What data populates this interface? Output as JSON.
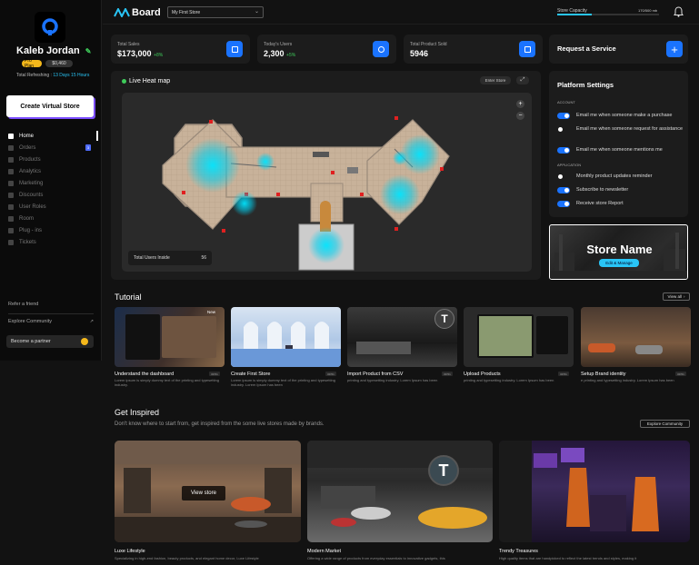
{
  "sidebar": {
    "user": {
      "name": "Kaleb Jordan",
      "plan_badge": "Pro Plan",
      "balance_badge": "$0,460",
      "refresh_label": "Total Refreshing :",
      "refresh_value": "13 Days 15 Hours"
    },
    "create_button": "Create Virtual Store",
    "nav": [
      {
        "label": "Home",
        "icon": "home-icon",
        "active": true
      },
      {
        "label": "Orders",
        "icon": "orders-icon",
        "badge": "3"
      },
      {
        "label": "Products",
        "icon": "products-icon"
      },
      {
        "label": "Analytics",
        "icon": "analytics-icon"
      },
      {
        "label": "Marketing",
        "icon": "marketing-icon"
      },
      {
        "label": "Discounts",
        "icon": "discounts-icon"
      },
      {
        "label": "User Roles",
        "icon": "user-roles-icon"
      },
      {
        "label": "Room",
        "icon": "room-icon"
      },
      {
        "label": "Plug - ins",
        "icon": "plugins-icon"
      },
      {
        "label": "Tickets",
        "icon": "tickets-icon"
      }
    ],
    "refer": "Refer a friend",
    "explore_community": "Explore Community",
    "partner": "Become a partner"
  },
  "topbar": {
    "title": "Board",
    "store_select": "My First Store",
    "capacity_label": "Store Capacity",
    "capacity_value": "170/500 mb",
    "capacity_fraction": 0.34
  },
  "stats": [
    {
      "label": "Total Sales",
      "value": "$173,000",
      "delta": "+8%",
      "icon": "cart-icon"
    },
    {
      "label": "Today's Users",
      "value": "2,300",
      "delta": "+5%",
      "icon": "globe-icon"
    },
    {
      "label": "Total Product Sold",
      "value": "5946",
      "delta": "",
      "icon": "document-icon"
    }
  ],
  "request_service": "Request a Service",
  "heatmap": {
    "title": "Live Heat map",
    "enter_store": "Enter Store",
    "users_inside_label": "Total Users Inside",
    "users_inside_value": "56"
  },
  "settings": {
    "title": "Platform Settings",
    "account_label": "ACCOUNT",
    "account": [
      {
        "label": "Email me when someone make a purchase",
        "on": true
      },
      {
        "label": "Email me when someone request for assistance",
        "on": false
      },
      {
        "label": "Email me when someone mentions me",
        "on": true
      }
    ],
    "application_label": "APPLICATION",
    "application": [
      {
        "label": "Monthly product updates reminder",
        "on": false
      },
      {
        "label": "Subscribe to newsletter",
        "on": true
      },
      {
        "label": "Receive store Report",
        "on": true
      }
    ]
  },
  "store_promo": {
    "title": "Store Name",
    "button": "Edit & Manage"
  },
  "tutorial": {
    "title": "Tutorial",
    "view_all": "View all",
    "new_badge": "New",
    "items": [
      {
        "title": "Understand the dashboard",
        "duration": "00:51",
        "desc": "Lorem ipsum is simply dummy text of the printing and typesetting industry."
      },
      {
        "title": "Create First Store",
        "duration": "00:51",
        "desc": "Lorem ipsum is simply dummy text of the printing and typesetting industry. Lorem Ipsum has been"
      },
      {
        "title": "Import Product from CSV",
        "duration": "00:51",
        "desc": "printing and typesetting industry. Lorem Ipsum has been"
      },
      {
        "title": "Upload Products",
        "duration": "00:51",
        "desc": "printing and typesetting industry. Lorem Ipsum has been"
      },
      {
        "title": "Setup Brand identity",
        "duration": "00:51",
        "desc": "e printing and typesetting industry. Lorem Ipsum has been"
      }
    ]
  },
  "inspired": {
    "title": "Get Inspired",
    "subtitle": "Don't know where to start from, get inspired from the some live stores made by brands.",
    "explore": "Explore Community",
    "view_store": "View store",
    "avatar_letter": "T",
    "items": [
      {
        "title": "Luxe Lifestyle",
        "desc": "Specializing in high-end fashion, beauty products, and elegant home decor, Luxe Lifestyle"
      },
      {
        "title": "Modern Market",
        "desc": "Offering a wide range of products from everyday essentials to innovative gadgets, this"
      },
      {
        "title": "Trendy Treasures",
        "desc": "High quality items that are handpicked to reflect the latest trends and styles, making it"
      }
    ]
  },
  "colors": {
    "accent": "#1a73ff",
    "cyan": "#29c5f6",
    "success": "#3ecb5a",
    "partner_coin": "#f5b81b"
  }
}
